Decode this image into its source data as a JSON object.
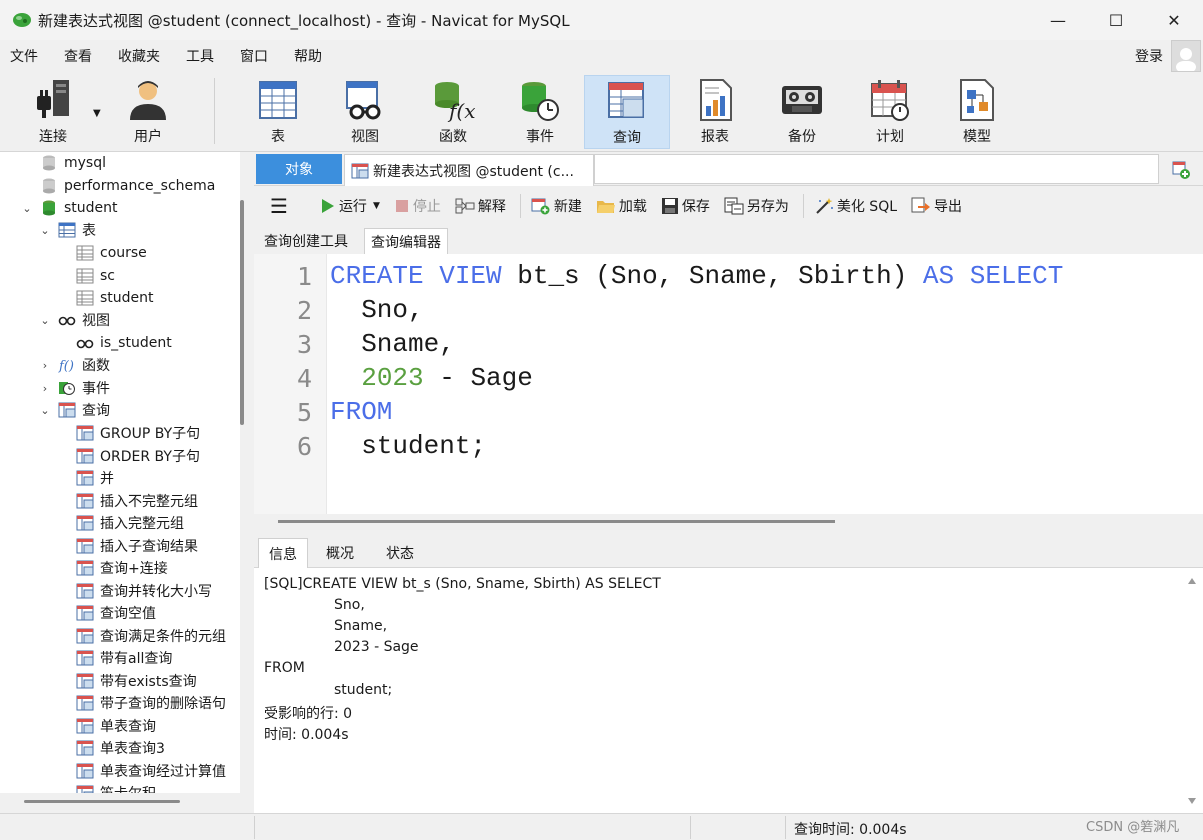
{
  "window": {
    "title": "新建表达式视图 @student (connect_localhost) - 查询 - Navicat for MySQL",
    "minimize": "—",
    "maximize": "☐",
    "close": "✕"
  },
  "menu": {
    "items": [
      "文件",
      "查看",
      "收藏夹",
      "工具",
      "窗口",
      "帮助"
    ],
    "login": "登录"
  },
  "toolbar": {
    "connect": "连接",
    "user": "用户",
    "table": "表",
    "view": "视图",
    "function": "函数",
    "event": "事件",
    "query": "查询",
    "report": "报表",
    "backup": "备份",
    "schedule": "计划",
    "model": "模型"
  },
  "tree": {
    "db_mysql": "mysql",
    "db_perf": "performance_schema",
    "db_student": "student",
    "tables": "表",
    "t_course": "course",
    "t_sc": "sc",
    "t_student": "student",
    "views": "视图",
    "v_is_student": "is_student",
    "functions": "函数",
    "events": "事件",
    "queries": "查询",
    "query_items": [
      "GROUP BY子句",
      "ORDER BY子句",
      "并",
      "插入不完整元组",
      "插入完整元组",
      "插入子查询结果",
      "查询+连接",
      "查询并转化大小写",
      "查询空值",
      "查询满足条件的元组",
      "带有all查询",
      "带有exists查询",
      "带子查询的删除语句",
      "单表查询",
      "单表查询3",
      "单表查询经过计算值",
      "笛卡尔积"
    ]
  },
  "tabs": {
    "objects": "对象",
    "query_tab": "新建表达式视图 @student (c..."
  },
  "query_toolbar": {
    "run": "运行",
    "stop": "停止",
    "explain": "解释",
    "new": "新建",
    "load": "加载",
    "save": "保存",
    "save_as": "另存为",
    "beautify": "美化 SQL",
    "export": "导出"
  },
  "sub_tabs": {
    "builder": "查询创建工具",
    "editor": "查询编辑器"
  },
  "editor": {
    "line_numbers": [
      "1",
      "2",
      "3",
      "4",
      "5",
      "6"
    ],
    "l1_create": "CREATE VIEW",
    "l1_mid": " bt_s (Sno, Sname, Sbirth) ",
    "l1_as": "AS SELECT",
    "l2": "  Sno,",
    "l3": "  Sname,",
    "l4_num": "2023",
    "l4_rest": " - Sage",
    "l5": "FROM",
    "l6": "  student;"
  },
  "result_tabs": {
    "info": "信息",
    "profile": "概况",
    "status": "状态"
  },
  "info": {
    "line1": "[SQL]CREATE VIEW bt_s (Sno, Sname, Sbirth) AS SELECT",
    "line2": "Sno,",
    "line3": "Sname,",
    "line4": "2023 - Sage",
    "line5": "FROM",
    "line6": "student;",
    "line7": "受影响的行: 0",
    "line8": "时间: 0.004s"
  },
  "status": {
    "query_time": "查询时间: 0.004s",
    "watermark": "CSDN @箬渊凡"
  }
}
